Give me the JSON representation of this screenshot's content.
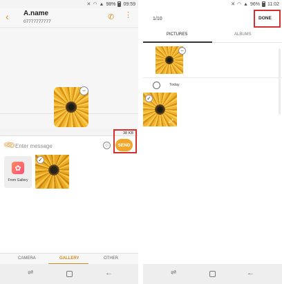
{
  "left": {
    "status": {
      "icons": [
        "mute-icon",
        "wifi-icon",
        "signal-icon",
        "battery-icon"
      ],
      "battery": "98%",
      "time": "09:59"
    },
    "header": {
      "name": "A.name",
      "number": "07777777777"
    },
    "attachment": {
      "remove_glyph": "−"
    },
    "compose": {
      "placeholder": "Enter message",
      "size": "38 KB",
      "send_label": "SEND"
    },
    "gallery": {
      "from_gallery_label": "From Gallery",
      "check_glyph": "✓"
    },
    "tabs": {
      "camera": "CAMERA",
      "gallery": "GALLERY",
      "other": "OTHER"
    }
  },
  "right": {
    "status": {
      "icons": [
        "mute-icon",
        "wifi-icon",
        "signal-icon",
        "battery-icon"
      ],
      "battery": "96%",
      "time": "11:02"
    },
    "header": {
      "count": "1/10",
      "done_label": "DONE"
    },
    "tabs": {
      "pictures": "PICTURES",
      "albums": "ALBUMS"
    },
    "section": {
      "today": "Today"
    }
  },
  "nav": {
    "recent_glyph": "⇌",
    "back_glyph": "←"
  },
  "colors": {
    "accent": "#f3a72a",
    "accent_text": "#d48a1c",
    "highlight": "#d32f2f"
  }
}
